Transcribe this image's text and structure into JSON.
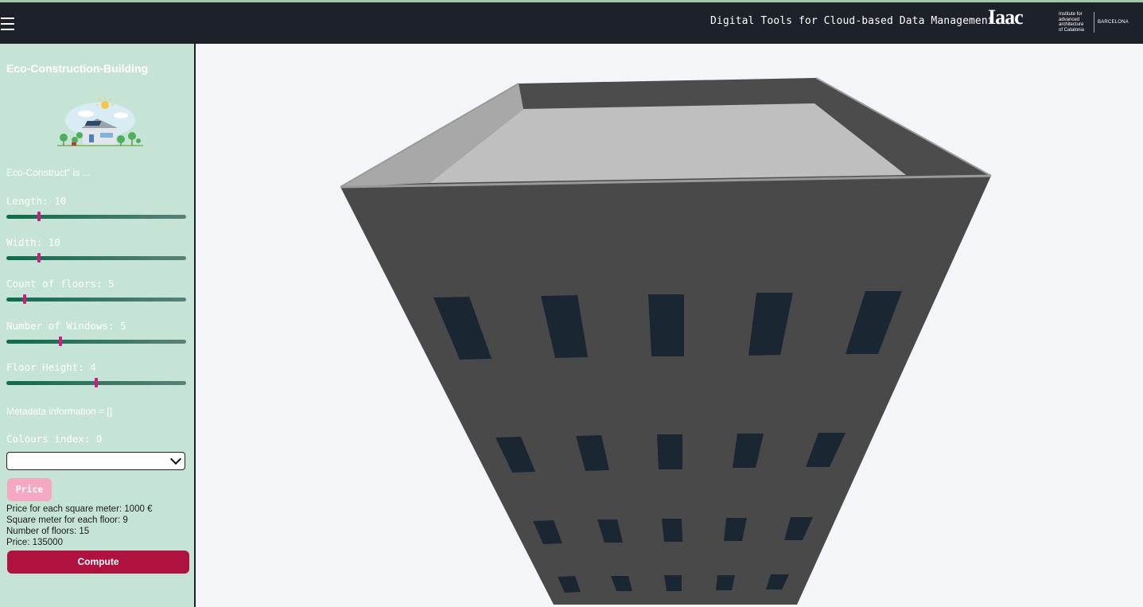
{
  "header": {
    "title": "Digital Tools for Cloud-based Data Management",
    "logo_mark": "Iaac",
    "logo_lines": [
      "Institute for",
      "advanced",
      "architecture",
      "of Catalonia"
    ],
    "logo_city": "BARCELONA",
    "background": "#1c212a"
  },
  "sidebar": {
    "title": "Eco-Construction-Building",
    "intro": "Eco-Construct\" is ...",
    "background": "#c6e4d6",
    "sliders": [
      {
        "label": "Length:",
        "value": "10",
        "fraction": 0.18
      },
      {
        "label": "Width:",
        "value": "10",
        "fraction": 0.18
      },
      {
        "label": "Count of floors:",
        "value": "5",
        "fraction": 0.1
      },
      {
        "label": "Number of Windows:",
        "value": "5",
        "fraction": 0.3
      },
      {
        "label": "Floor Height:",
        "value": "4",
        "fraction": 0.5
      }
    ],
    "metadata": "Metadata information = []",
    "colours_label": "Colours index:",
    "colours_value": "0",
    "select_value": "",
    "price_button": "Price",
    "info": {
      "price_per_sqm": "Price for each square meter: 1000 €",
      "sqm_per_floor": "Square meter for each floor: 9",
      "floors": "Number of floors: 15",
      "price": "Price: 135000"
    },
    "compute_button": "Compute"
  },
  "scene": {
    "background": "#f3f5f9",
    "building_color": "#494949",
    "window_color": "#1a2733",
    "roof_color": "#bdbdbd"
  }
}
